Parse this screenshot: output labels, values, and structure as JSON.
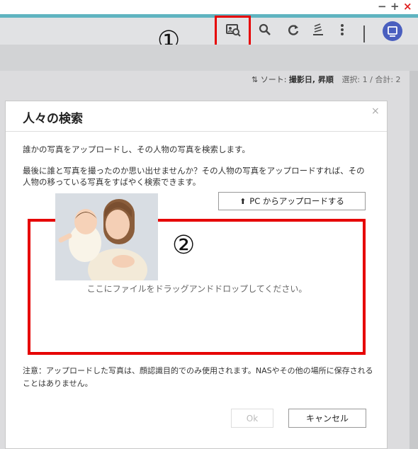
{
  "window": {
    "minimize_label": "−",
    "maximize_label": "+",
    "close_label": "×",
    "accent_color": "#5fb4c0"
  },
  "toolbar": {
    "icons": [
      "face-search-icon",
      "search-icon",
      "refresh-icon",
      "sort-icon",
      "more-vert-icon",
      "user-avatar"
    ],
    "annotation_1": "①"
  },
  "sortbar": {
    "sort_prefix": "ソート: ",
    "sort_value": "撮影日, 昇順",
    "selection": "選択: 1 / 合計: 2"
  },
  "dialog": {
    "title": "人々の検索",
    "close_label": "×",
    "intro": "誰かの写真をアップロードし、その人物の写真を検索します。",
    "description": "最後に誰と写真を撮ったのか思い出せませんか？その人物の写真をアップロードすれば、その人物の移っている写真をすばやく検索できます。",
    "upload_button": "PC からアップロードする",
    "drop_text": "ここにファイルをドラッグアンドドロップしてください。",
    "annotation_2": "②",
    "note": "注意：アップロードした写真は、顔認識目的でのみ使用されます。NASやその他の場所に保存されることはありません。",
    "ok_button": "Ok",
    "cancel_button": "キャンセル"
  },
  "colors": {
    "highlight": "#e60000",
    "avatar": "#4a5fbf"
  }
}
